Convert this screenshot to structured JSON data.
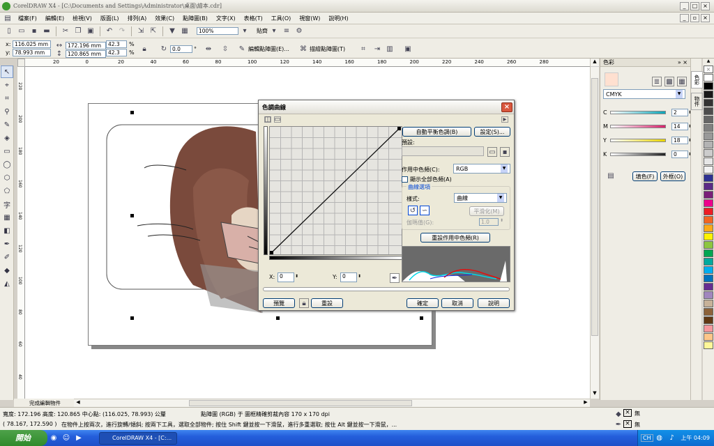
{
  "app": {
    "title": "CorelDRAW X4 - [C:\\Documents and Settings\\Administrator\\桌面\\繪本.cdr]"
  },
  "menu": [
    "檔案(F)",
    "編輯(E)",
    "檢視(V)",
    "版面(L)",
    "排列(A)",
    "效果(C)",
    "點陣圖(B)",
    "文字(X)",
    "表格(T)",
    "工具(O)",
    "視窗(W)",
    "說明(H)"
  ],
  "toolbar": {
    "zoom": "100%",
    "snap_label": "貼齊"
  },
  "property_bar": {
    "x": "116.025 mm",
    "y": "78.993 mm",
    "width": "172.196 mm",
    "height": "120.865 mm",
    "scale_x": "42.3",
    "scale_y": "42.3",
    "pct": "%",
    "angle": "0.0",
    "deg": "°",
    "edit_bitmap": "編輯點陣圖(E)...",
    "trace_bitmap": "描繪點陣圖(T)"
  },
  "ruler": {
    "h_ticks": [
      "20",
      "0",
      "20",
      "40",
      "60",
      "80",
      "100",
      "120",
      "140",
      "160",
      "180",
      "200",
      "220",
      "240",
      "260",
      "280"
    ],
    "v_ticks": [
      "220",
      "200",
      "180",
      "160",
      "140",
      "120",
      "100",
      "80",
      "60",
      "40"
    ],
    "unit": "公釐"
  },
  "page_tab": "完成編輯物件",
  "docker": {
    "title": "色彩",
    "model": "CMYK",
    "channels": [
      {
        "label": "C",
        "value": "2",
        "color": "#0aa5b8"
      },
      {
        "label": "M",
        "value": "14",
        "color": "#d8206a"
      },
      {
        "label": "Y",
        "value": "18",
        "color": "#e8d400"
      },
      {
        "label": "K",
        "value": "0",
        "color": "#202020"
      }
    ],
    "fill_btn": "填色(F)",
    "outline_btn": "外框(O)"
  },
  "sidetabs": [
    "色彩",
    "物件"
  ],
  "palette": [
    "#ffffff",
    "#000000",
    "#1a1a1a",
    "#333333",
    "#4d4d4d",
    "#666666",
    "#808080",
    "#999999",
    "#b3b3b3",
    "#cccccc",
    "#e6e6e6",
    "#f2f2f2",
    "#2e3192",
    "#5b2a86",
    "#7a1f78",
    "#ec008c",
    "#ed1c24",
    "#f26522",
    "#fbaa19",
    "#fff200",
    "#8dc63f",
    "#00a651",
    "#00a99d",
    "#00aeef",
    "#0072bc",
    "#662d91",
    "#a186be",
    "#c7b299",
    "#8c6239",
    "#603813",
    "#f5989d",
    "#fdc689",
    "#fff799"
  ],
  "dialog": {
    "title": "色調曲線",
    "auto_balance": "自動平衡色調(B)",
    "settings": "設定(S)...",
    "preset_label": "預設:",
    "active_channel_label": "作用中色頻(C):",
    "channel_value": "RGB",
    "show_all": "顯示全部色頻(A)",
    "curve_group": "曲線選項",
    "style_label": "樣式:",
    "style_value": "曲線",
    "smooth": "平滑化(M)",
    "threshold_label": "伽瑪值(G):",
    "threshold_value": "1.0",
    "reset_channel": "重設作用中色頻(R)",
    "x_label": "X:",
    "x_value": "0",
    "y_label": "Y:",
    "y_value": "0",
    "preview": "預覽",
    "reset": "重設",
    "ok": "確定",
    "cancel": "取消",
    "help": "說明"
  },
  "status": {
    "line1": "寬度: 172.196 高度: 120.865 中心點: (116.025, 78.993) 公釐",
    "object_info": "點陣圖 (RGB) 于 圖框精確剪裁內容 170 x 170 dpi",
    "line2": "( 78.167, 172.590 )",
    "hint": "在物件上按兩次，進行旋轉/傾斜; 按兩下工具，選取全部物件; 按住 Shift 鍵並按一下滑鼠，進行多重選取; 按住 Alt 鍵並按一下滑鼠，...",
    "fill_none": "無",
    "outline_none": "無"
  },
  "taskbar": {
    "start": "開始",
    "task": "CorelDRAW X4 - [C:...",
    "lang": "CH",
    "clock": "上午 04:09"
  }
}
